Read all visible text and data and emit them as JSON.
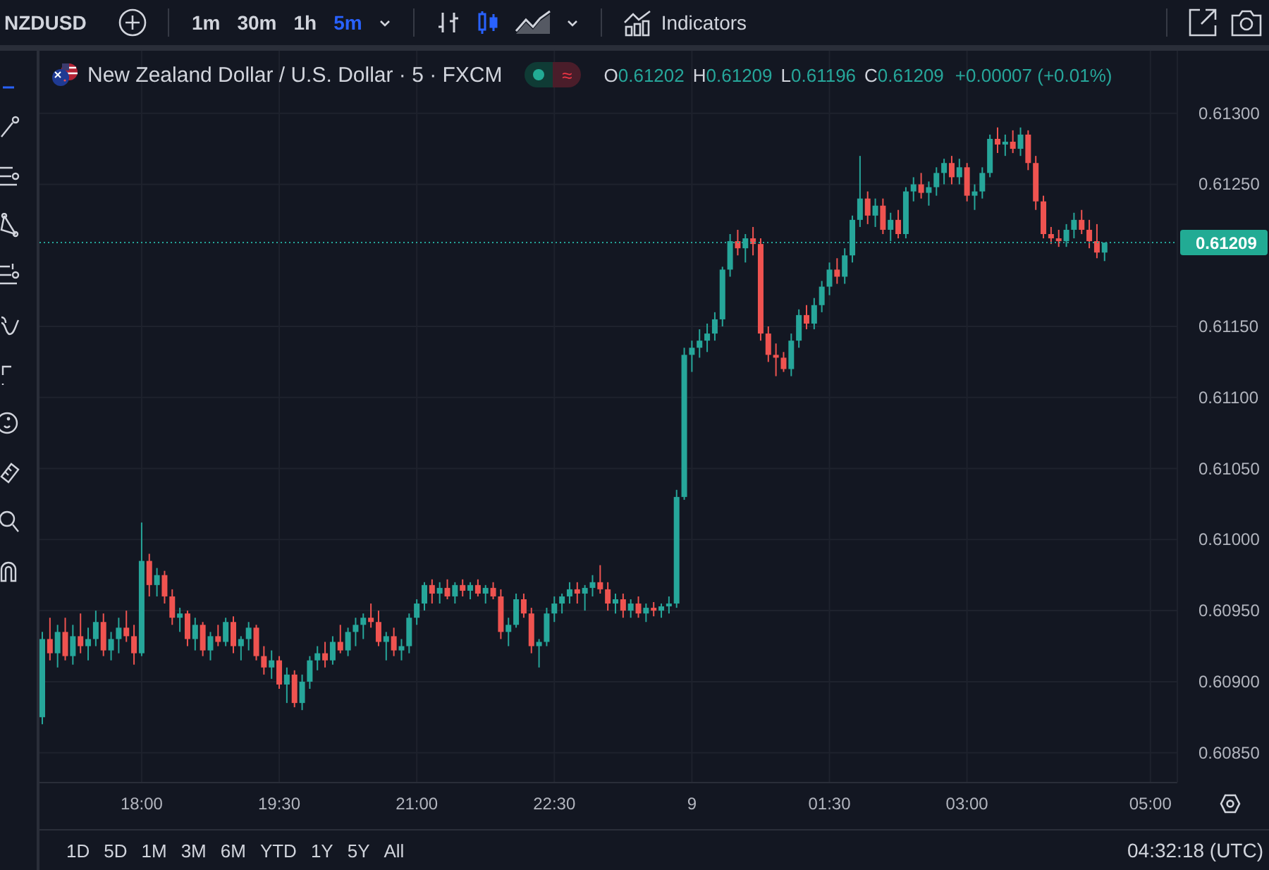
{
  "toolbar": {
    "symbol": "NZDUSD",
    "intervals": [
      {
        "label": "1m",
        "selected": false
      },
      {
        "label": "30m",
        "selected": false
      },
      {
        "label": "1h",
        "selected": false
      },
      {
        "label": "5m",
        "selected": true
      }
    ],
    "chart_styles": [
      {
        "kind": "bars",
        "selected": false
      },
      {
        "kind": "candles",
        "selected": true
      },
      {
        "kind": "area",
        "selected": false
      }
    ],
    "indicators_label": "Indicators"
  },
  "legend": {
    "title": "New Zealand Dollar / U.S. Dollar · 5 · FXCM",
    "badge_glyph": "≈",
    "ohlc": [
      {
        "key": "O",
        "value": "0.61202"
      },
      {
        "key": "H",
        "value": "0.61209"
      },
      {
        "key": "L",
        "value": "0.61196"
      },
      {
        "key": "C",
        "value": "0.61209"
      }
    ],
    "change": "+0.00007 (+0.01%)"
  },
  "chart": {
    "chart_data": {
      "type": "candlestick",
      "categories": [
        null,
        null,
        null,
        null,
        null,
        null,
        null,
        null,
        null,
        null,
        null,
        null,
        null,
        "18:00",
        null,
        null,
        null,
        null,
        null,
        null,
        null,
        null,
        null,
        null,
        null,
        null,
        null,
        null,
        null,
        null,
        null,
        "19:30",
        null,
        null,
        null,
        null,
        null,
        null,
        null,
        null,
        null,
        null,
        null,
        null,
        null,
        null,
        null,
        null,
        null,
        "21:00",
        null,
        null,
        null,
        null,
        null,
        null,
        null,
        null,
        null,
        null,
        null,
        null,
        null,
        null,
        null,
        null,
        null,
        "22:30",
        null,
        null,
        null,
        null,
        null,
        null,
        null,
        null,
        null,
        null,
        null,
        null,
        null,
        null,
        null,
        null,
        null,
        "9",
        null,
        null,
        null,
        null,
        null,
        null,
        null,
        null,
        null,
        null,
        null,
        null,
        null,
        null,
        null,
        null,
        null,
        "01:30",
        null,
        null,
        null,
        null,
        null,
        null,
        null,
        null,
        null,
        null,
        null,
        null,
        null,
        null,
        null,
        null,
        null,
        "03:00",
        null,
        null,
        null,
        null,
        null,
        null,
        null,
        null,
        null,
        null,
        null,
        null,
        null,
        null,
        null,
        null,
        null,
        null,
        null,
        null,
        null,
        null,
        null,
        "05:00"
      ],
      "ohlc": [
        [
          0.60875,
          0.60935,
          0.6087,
          0.6093
        ],
        [
          0.6093,
          0.60945,
          0.60915,
          0.6092
        ],
        [
          0.6092,
          0.6094,
          0.6091,
          0.60935
        ],
        [
          0.60935,
          0.60945,
          0.60915,
          0.60918
        ],
        [
          0.60918,
          0.6094,
          0.60912,
          0.60932
        ],
        [
          0.60932,
          0.60948,
          0.6092,
          0.60925
        ],
        [
          0.60925,
          0.60938,
          0.60915,
          0.6093
        ],
        [
          0.6093,
          0.6095,
          0.60925,
          0.60942
        ],
        [
          0.60942,
          0.60948,
          0.60918,
          0.60922
        ],
        [
          0.60922,
          0.60935,
          0.60915,
          0.6093
        ],
        [
          0.6093,
          0.60945,
          0.6092,
          0.60938
        ],
        [
          0.60938,
          0.6095,
          0.60928,
          0.60932
        ],
        [
          0.60932,
          0.6094,
          0.60912,
          0.6092
        ],
        [
          0.6092,
          0.61012,
          0.60918,
          0.60985
        ],
        [
          0.60985,
          0.6099,
          0.6096,
          0.60968
        ],
        [
          0.60968,
          0.6098,
          0.6096,
          0.60975
        ],
        [
          0.60975,
          0.60978,
          0.60955,
          0.6096
        ],
        [
          0.6096,
          0.60965,
          0.6094,
          0.60945
        ],
        [
          0.60945,
          0.60952,
          0.60935,
          0.60948
        ],
        [
          0.60948,
          0.6095,
          0.60925,
          0.6093
        ],
        [
          0.6093,
          0.60945,
          0.60922,
          0.6094
        ],
        [
          0.6094,
          0.60942,
          0.60918,
          0.60922
        ],
        [
          0.60922,
          0.60935,
          0.60915,
          0.60932
        ],
        [
          0.60932,
          0.6094,
          0.60925,
          0.60928
        ],
        [
          0.60928,
          0.60945,
          0.60925,
          0.60942
        ],
        [
          0.60942,
          0.60946,
          0.6092,
          0.60925
        ],
        [
          0.60925,
          0.60932,
          0.60915,
          0.6093
        ],
        [
          0.6093,
          0.60942,
          0.60922,
          0.60938
        ],
        [
          0.60938,
          0.6094,
          0.60915,
          0.60918
        ],
        [
          0.60918,
          0.60925,
          0.60905,
          0.6091
        ],
        [
          0.6091,
          0.60922,
          0.60902,
          0.60915
        ],
        [
          0.60915,
          0.60918,
          0.60895,
          0.60898
        ],
        [
          0.60898,
          0.6091,
          0.60885,
          0.60905
        ],
        [
          0.60905,
          0.60908,
          0.60882,
          0.60885
        ],
        [
          0.60885,
          0.60905,
          0.6088,
          0.609
        ],
        [
          0.609,
          0.60918,
          0.60895,
          0.60915
        ],
        [
          0.60915,
          0.60925,
          0.60908,
          0.6092
        ],
        [
          0.6092,
          0.60928,
          0.6091,
          0.60915
        ],
        [
          0.60915,
          0.60932,
          0.60912,
          0.60928
        ],
        [
          0.60928,
          0.6094,
          0.6092,
          0.60922
        ],
        [
          0.60922,
          0.60938,
          0.60918,
          0.60935
        ],
        [
          0.60935,
          0.60945,
          0.60925,
          0.6094
        ],
        [
          0.6094,
          0.60948,
          0.6093,
          0.60945
        ],
        [
          0.60945,
          0.60955,
          0.60938,
          0.60942
        ],
        [
          0.60942,
          0.6095,
          0.60925,
          0.60928
        ],
        [
          0.60928,
          0.60935,
          0.60915,
          0.60932
        ],
        [
          0.60932,
          0.60938,
          0.60918,
          0.60922
        ],
        [
          0.60922,
          0.6093,
          0.60915,
          0.60925
        ],
        [
          0.60925,
          0.60948,
          0.6092,
          0.60945
        ],
        [
          0.60945,
          0.60958,
          0.6094,
          0.60955
        ],
        [
          0.60955,
          0.6097,
          0.6095,
          0.60968
        ],
        [
          0.60968,
          0.60972,
          0.60955,
          0.60962
        ],
        [
          0.60962,
          0.6097,
          0.60955,
          0.60966
        ],
        [
          0.60966,
          0.60972,
          0.60958,
          0.6096
        ],
        [
          0.6096,
          0.6097,
          0.60955,
          0.60968
        ],
        [
          0.60968,
          0.60972,
          0.6096,
          0.60964
        ],
        [
          0.60964,
          0.6097,
          0.60958,
          0.60968
        ],
        [
          0.60968,
          0.60972,
          0.6096,
          0.60962
        ],
        [
          0.60962,
          0.60968,
          0.60955,
          0.60966
        ],
        [
          0.60966,
          0.6097,
          0.60958,
          0.6096
        ],
        [
          0.6096,
          0.60965,
          0.6093,
          0.60935
        ],
        [
          0.60935,
          0.60945,
          0.60925,
          0.6094
        ],
        [
          0.6094,
          0.60962,
          0.60938,
          0.60958
        ],
        [
          0.60958,
          0.60962,
          0.60945,
          0.60948
        ],
        [
          0.60948,
          0.60952,
          0.6092,
          0.60925
        ],
        [
          0.60925,
          0.6093,
          0.6091,
          0.60928
        ],
        [
          0.60928,
          0.60952,
          0.60925,
          0.60948
        ],
        [
          0.60948,
          0.6096,
          0.60942,
          0.60955
        ],
        [
          0.60955,
          0.60962,
          0.60948,
          0.6096
        ],
        [
          0.6096,
          0.6097,
          0.60955,
          0.60965
        ],
        [
          0.60965,
          0.6097,
          0.60955,
          0.60962
        ],
        [
          0.60962,
          0.60968,
          0.6095,
          0.60966
        ],
        [
          0.60966,
          0.60975,
          0.6096,
          0.6097
        ],
        [
          0.6097,
          0.60982,
          0.60962,
          0.60965
        ],
        [
          0.60965,
          0.6097,
          0.6095,
          0.60955
        ],
        [
          0.60955,
          0.60962,
          0.60948,
          0.60958
        ],
        [
          0.60958,
          0.60962,
          0.60945,
          0.6095
        ],
        [
          0.6095,
          0.60958,
          0.60945,
          0.60955
        ],
        [
          0.60955,
          0.6096,
          0.60945,
          0.60948
        ],
        [
          0.60948,
          0.60955,
          0.60942,
          0.60952
        ],
        [
          0.60952,
          0.60956,
          0.60946,
          0.6095
        ],
        [
          0.6095,
          0.60955,
          0.60945,
          0.60953
        ],
        [
          0.60953,
          0.6096,
          0.60948,
          0.60955
        ],
        [
          0.60955,
          0.61035,
          0.60952,
          0.6103
        ],
        [
          0.6103,
          0.61135,
          0.61028,
          0.6113
        ],
        [
          0.6113,
          0.6114,
          0.61118,
          0.61135
        ],
        [
          0.61135,
          0.61148,
          0.61128,
          0.6114
        ],
        [
          0.6114,
          0.61152,
          0.61132,
          0.61145
        ],
        [
          0.61145,
          0.6116,
          0.6114,
          0.61155
        ],
        [
          0.61155,
          0.61192,
          0.6115,
          0.6119
        ],
        [
          0.6119,
          0.61215,
          0.61185,
          0.6121
        ],
        [
          0.6121,
          0.61218,
          0.612,
          0.61205
        ],
        [
          0.61205,
          0.61215,
          0.61195,
          0.61212
        ],
        [
          0.61212,
          0.6122,
          0.612,
          0.61208
        ],
        [
          0.61208,
          0.61212,
          0.6114,
          0.61145
        ],
        [
          0.61145,
          0.6115,
          0.61125,
          0.6113
        ],
        [
          0.6113,
          0.61138,
          0.61115,
          0.61128
        ],
        [
          0.61128,
          0.61132,
          0.61118,
          0.6112
        ],
        [
          0.6112,
          0.61145,
          0.61115,
          0.6114
        ],
        [
          0.6114,
          0.61162,
          0.61135,
          0.61158
        ],
        [
          0.61158,
          0.61165,
          0.61148,
          0.61152
        ],
        [
          0.61152,
          0.6117,
          0.61148,
          0.61165
        ],
        [
          0.61165,
          0.61182,
          0.6116,
          0.61178
        ],
        [
          0.61178,
          0.61195,
          0.61172,
          0.6119
        ],
        [
          0.6119,
          0.61198,
          0.6118,
          0.61185
        ],
        [
          0.61185,
          0.61205,
          0.6118,
          0.612
        ],
        [
          0.612,
          0.61228,
          0.61195,
          0.61225
        ],
        [
          0.61225,
          0.6127,
          0.6122,
          0.6124
        ],
        [
          0.6124,
          0.61245,
          0.61222,
          0.61228
        ],
        [
          0.61228,
          0.6124,
          0.6122,
          0.61235
        ],
        [
          0.61235,
          0.6124,
          0.61215,
          0.61218
        ],
        [
          0.61218,
          0.6123,
          0.6121,
          0.61225
        ],
        [
          0.61225,
          0.61232,
          0.61212,
          0.61215
        ],
        [
          0.61215,
          0.61248,
          0.61212,
          0.61245
        ],
        [
          0.61245,
          0.61255,
          0.61238,
          0.6125
        ],
        [
          0.6125,
          0.61258,
          0.6124,
          0.61244
        ],
        [
          0.61244,
          0.61252,
          0.61235,
          0.61248
        ],
        [
          0.61248,
          0.61262,
          0.61242,
          0.61258
        ],
        [
          0.61258,
          0.61268,
          0.6125,
          0.61265
        ],
        [
          0.61265,
          0.6127,
          0.6125,
          0.61255
        ],
        [
          0.61255,
          0.61268,
          0.6125,
          0.61262
        ],
        [
          0.61262,
          0.61265,
          0.61238,
          0.61242
        ],
        [
          0.61242,
          0.6125,
          0.61232,
          0.61245
        ],
        [
          0.61245,
          0.61262,
          0.6124,
          0.61258
        ],
        [
          0.61258,
          0.61285,
          0.61255,
          0.61282
        ],
        [
          0.61282,
          0.6129,
          0.61272,
          0.61278
        ],
        [
          0.61278,
          0.61285,
          0.6127,
          0.6128
        ],
        [
          0.6128,
          0.61288,
          0.61272,
          0.61275
        ],
        [
          0.61275,
          0.6129,
          0.6127,
          0.61285
        ],
        [
          0.61285,
          0.61288,
          0.6126,
          0.61265
        ],
        [
          0.61265,
          0.6127,
          0.61232,
          0.61238
        ],
        [
          0.61238,
          0.61242,
          0.61212,
          0.61215
        ],
        [
          0.61215,
          0.6122,
          0.61208,
          0.61212
        ],
        [
          0.61212,
          0.61218,
          0.61206,
          0.6121
        ],
        [
          0.6121,
          0.61222,
          0.61206,
          0.61218
        ],
        [
          0.61218,
          0.6123,
          0.61212,
          0.61225
        ],
        [
          0.61225,
          0.61232,
          0.61215,
          0.61218
        ],
        [
          0.61218,
          0.61225,
          0.61205,
          0.6121
        ],
        [
          0.6121,
          0.61222,
          0.61198,
          0.61202
        ],
        [
          0.61202,
          0.61209,
          0.61196,
          0.61209
        ],
        null,
        null,
        null,
        null,
        null,
        null
      ],
      "ylim": [
        0.60829,
        0.61344
      ],
      "grid": true,
      "ref_lines": [
        {
          "axis": "y",
          "value": 0.61209,
          "label": "0.61209",
          "color": "#26a69a"
        }
      ],
      "yticks": [
        {
          "value": 0.613,
          "label": "0.61300"
        },
        {
          "value": 0.6125,
          "label": "0.61250"
        },
        {
          "value": 0.6115,
          "label": "0.61150"
        },
        {
          "value": 0.611,
          "label": "0.61100"
        },
        {
          "value": 0.6105,
          "label": "0.61050"
        },
        {
          "value": 0.61,
          "label": "0.61000"
        },
        {
          "value": 0.6095,
          "label": "0.60950"
        },
        {
          "value": 0.609,
          "label": "0.60900"
        },
        {
          "value": 0.6085,
          "label": "0.60850"
        }
      ]
    }
  },
  "bottom": {
    "ranges": [
      "1D",
      "5D",
      "1M",
      "3M",
      "6M",
      "YTD",
      "1Y",
      "5Y",
      "All"
    ],
    "clock": "04:32:18 (UTC)"
  }
}
